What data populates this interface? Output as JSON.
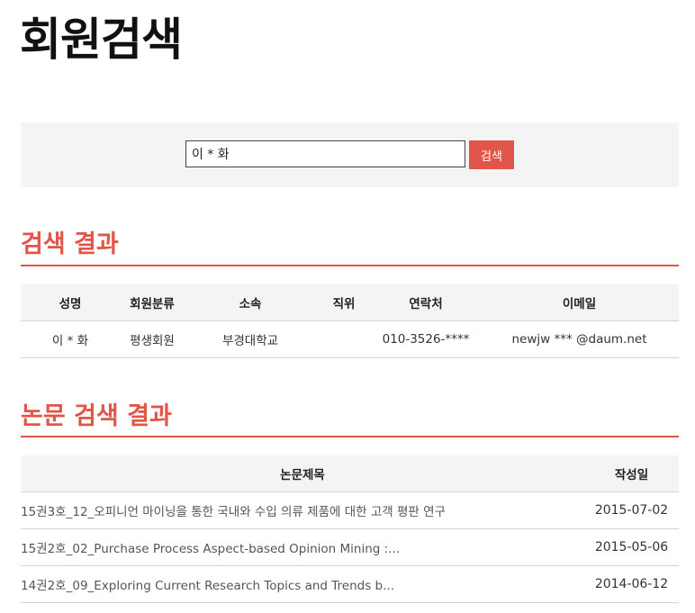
{
  "page": {
    "title": "회원검색"
  },
  "search": {
    "value": "이 * 화",
    "button_label": "검색"
  },
  "member_results": {
    "title": "검색 결과",
    "columns": [
      "성명",
      "회원분류",
      "소속",
      "직위",
      "연락처",
      "이메일"
    ],
    "rows": [
      [
        "이 * 화",
        "평생회원",
        "부경대학교",
        "",
        "010-3526-****",
        "newjw *** @daum.net"
      ]
    ]
  },
  "paper_results": {
    "title": "논문 검색 결과",
    "columns": [
      "논문제목",
      "작성일"
    ],
    "rows": [
      [
        "15권3호_12_오피니언 마이닝을 통한 국내와 수입 의류 제품에 대한 고객 평판 연구",
        "2015-07-02"
      ],
      [
        "15권2호_02_Purchase Process Aspect-based Opinion Mining :...",
        "2015-05-06"
      ],
      [
        "14권2호_09_Exploring Current Research Topics and Trends b...",
        "2014-06-12"
      ]
    ]
  },
  "colors": {
    "accent": "#e0574a",
    "panel_bg": "#f4f4f4"
  }
}
